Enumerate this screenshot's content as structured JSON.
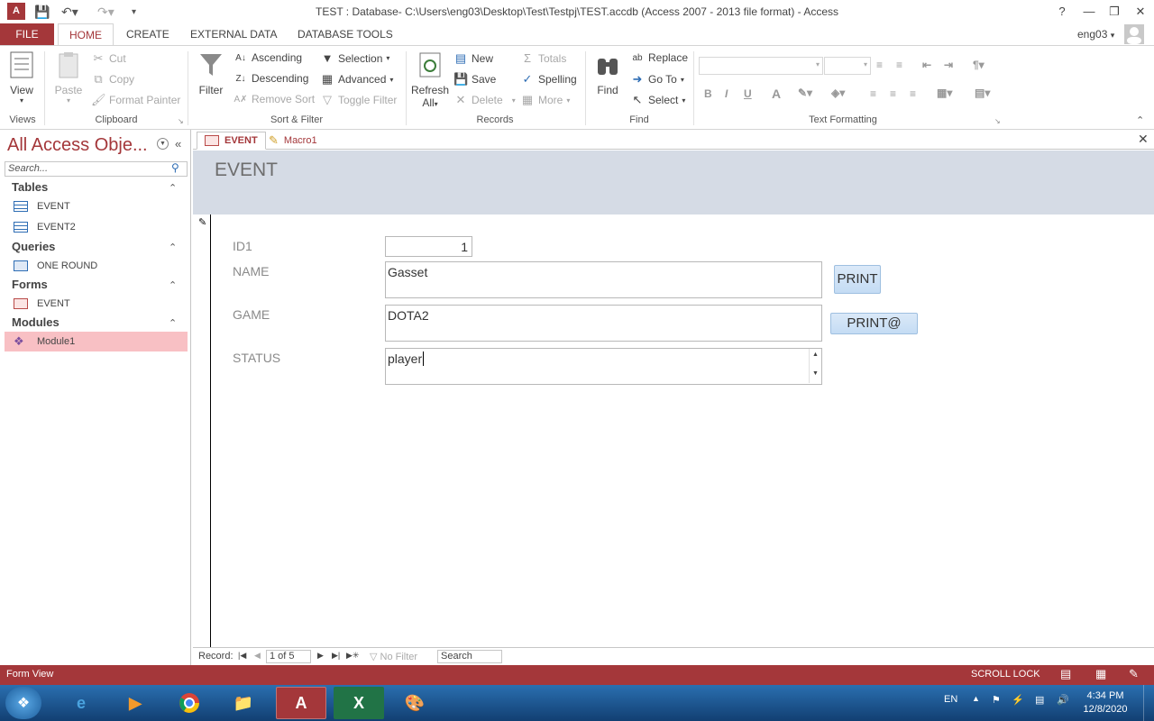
{
  "window": {
    "title": "TEST : Database- C:\\Users\\eng03\\Desktop\\Test\\Testpj\\TEST.accdb (Access 2007 - 2013 file format) - Access",
    "app_icon": "A",
    "help": "?"
  },
  "ribbon_tabs": [
    "FILE",
    "HOME",
    "CREATE",
    "EXTERNAL DATA",
    "DATABASE TOOLS"
  ],
  "user": "eng03",
  "ribbon": {
    "views": {
      "view": "View",
      "label": "Views"
    },
    "clipboard": {
      "paste": "Paste",
      "cut": "Cut",
      "copy": "Copy",
      "format_painter": "Format Painter",
      "label": "Clipboard"
    },
    "sort_filter": {
      "filter": "Filter",
      "ascending": "Ascending",
      "descending": "Descending",
      "remove_sort": "Remove Sort",
      "selection": "Selection",
      "advanced": "Advanced",
      "toggle_filter": "Toggle Filter",
      "label": "Sort & Filter"
    },
    "records": {
      "refresh": "Refresh",
      "refresh_all": "All",
      "new": "New",
      "save": "Save",
      "delete": "Delete",
      "totals": "Totals",
      "spelling": "Spelling",
      "more": "More",
      "label": "Records"
    },
    "find": {
      "find": "Find",
      "replace": "Replace",
      "goto": "Go To",
      "select": "Select",
      "label": "Find"
    },
    "text_formatting": {
      "bold": "B",
      "italic": "I",
      "underline": "U",
      "font_color": "A",
      "label": "Text Formatting"
    }
  },
  "nav": {
    "title": "All Access Obje...",
    "search_placeholder": "Search...",
    "sections": [
      {
        "name": "Tables",
        "items": [
          "EVENT",
          "EVENT2"
        ]
      },
      {
        "name": "Queries",
        "items": [
          "ONE ROUND"
        ]
      },
      {
        "name": "Forms",
        "items": [
          "EVENT"
        ]
      },
      {
        "name": "Modules",
        "items": [
          "Module1"
        ]
      }
    ]
  },
  "doc_tabs": [
    "EVENT",
    "Macro1"
  ],
  "form": {
    "title": "EVENT",
    "fields": [
      {
        "label": "ID1",
        "value": "1"
      },
      {
        "label": "NAME",
        "value": "Gasset"
      },
      {
        "label": "GAME",
        "value": "DOTA2"
      },
      {
        "label": "STATUS",
        "value": "player"
      }
    ],
    "buttons": [
      "PRINT",
      "PRINT@"
    ]
  },
  "record_nav": {
    "label": "Record:",
    "position": "1 of 5",
    "filter": "No Filter",
    "search": "Search"
  },
  "statusbar": {
    "view": "Form View",
    "scroll_lock": "SCROLL LOCK"
  },
  "taskbar": {
    "lang": "EN",
    "time": "4:34 PM",
    "date": "12/8/2020"
  },
  "colors": {
    "accent": "#a4373a",
    "header": "#d5dbe5",
    "selection": "#f8c0c4"
  }
}
